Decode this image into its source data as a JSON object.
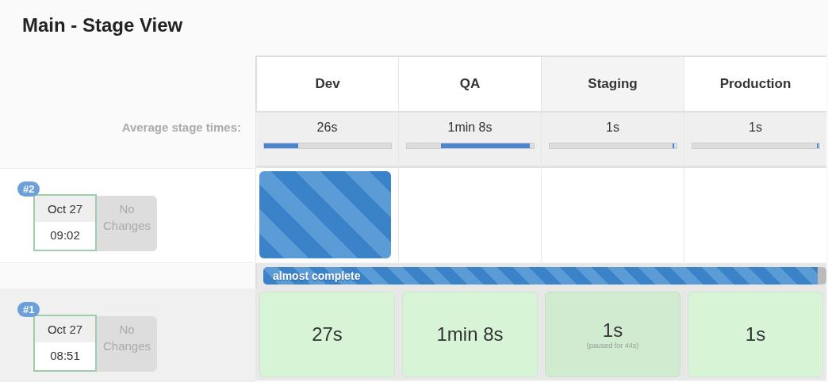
{
  "title": "Main - Stage View",
  "avg_label": "Average stage times:",
  "stages": [
    {
      "name": "Dev",
      "avg": "26s",
      "level": 0.27
    },
    {
      "name": "QA",
      "avg": "1min 8s",
      "level": 0.7
    },
    {
      "name": "Staging",
      "avg": "1s",
      "level": 0.015
    },
    {
      "name": "Production",
      "avg": "1s",
      "level": 0.015
    }
  ],
  "runs": [
    {
      "number": "#2",
      "date": "Oct 27",
      "time": "09:02",
      "changes": "No Changes",
      "cells": [
        {
          "kind": "running"
        },
        {
          "kind": "empty"
        },
        {
          "kind": "empty"
        },
        {
          "kind": "empty"
        }
      ],
      "progress": {
        "label": "almost complete",
        "level": 0.985
      }
    },
    {
      "number": "#1",
      "date": "Oct 27",
      "time": "08:51",
      "changes": "No Changes",
      "cells": [
        {
          "kind": "success",
          "duration": "27s"
        },
        {
          "kind": "success",
          "duration": "1min 8s"
        },
        {
          "kind": "paused",
          "duration": "1s",
          "note": "(paused for 44s)"
        },
        {
          "kind": "success",
          "duration": "1s"
        }
      ]
    }
  ]
}
